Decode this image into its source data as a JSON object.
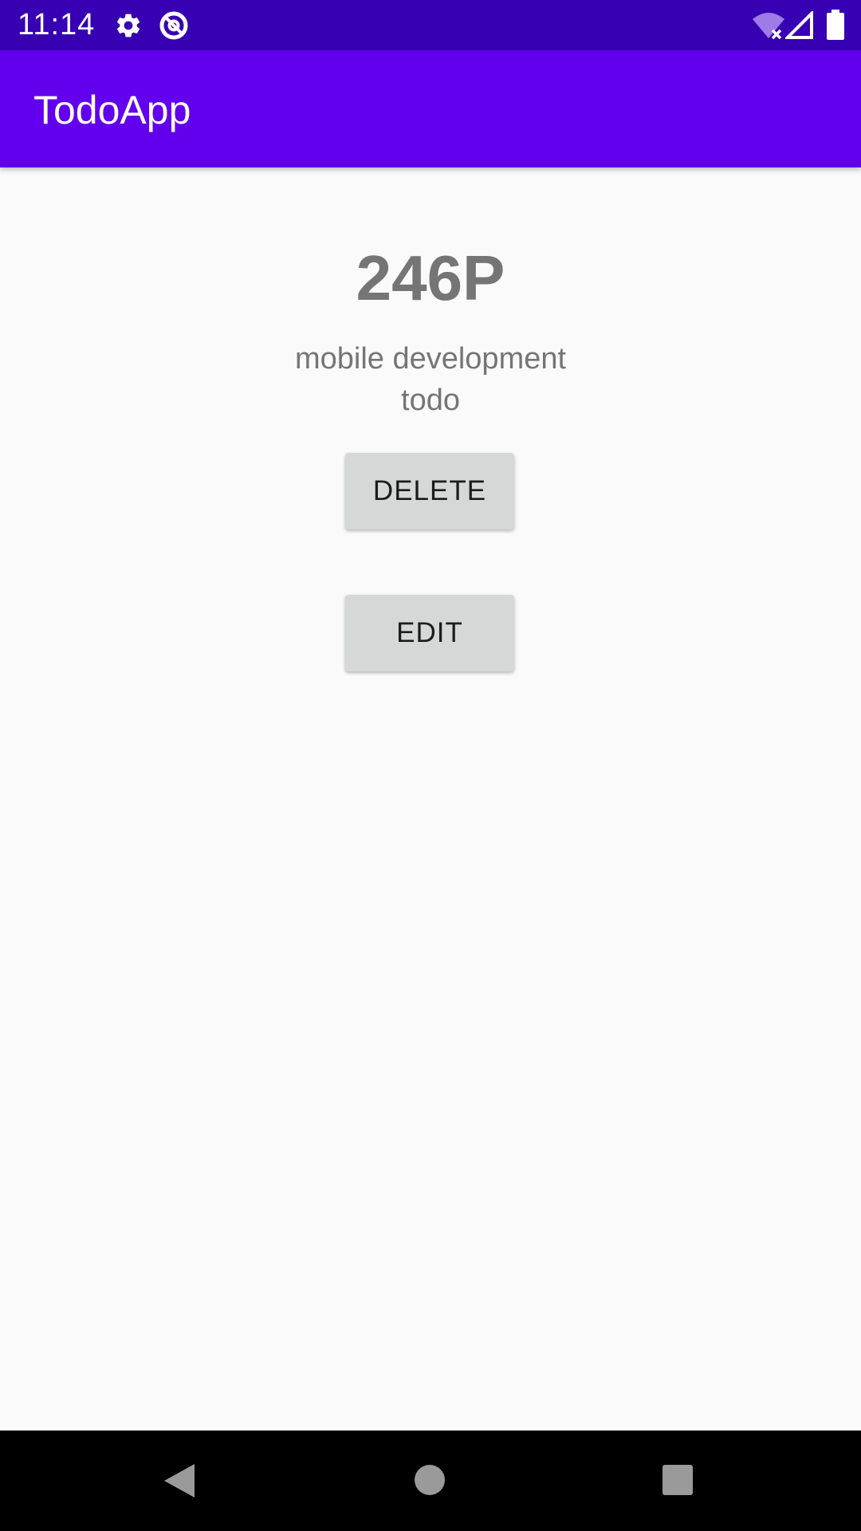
{
  "status_bar": {
    "time": "11:14",
    "icons": [
      "gear-icon",
      "at-sign-icon",
      "wifi-off-icon",
      "signal-icon",
      "battery-icon"
    ]
  },
  "app_bar": {
    "title": "TodoApp",
    "color": "#6200ee"
  },
  "todo": {
    "title": "246P",
    "description_line1": "mobile development",
    "description_line2": "todo"
  },
  "buttons": {
    "delete_label": "DELETE",
    "edit_label": "EDIT"
  },
  "nav_bar": {
    "icons": [
      "back-icon",
      "home-icon",
      "recents-icon"
    ]
  },
  "colors": {
    "status_bar": "#3700b3",
    "app_bar": "#6200ee",
    "background": "#fafafa",
    "button": "#d6d7d7",
    "text_secondary": "#757575"
  }
}
